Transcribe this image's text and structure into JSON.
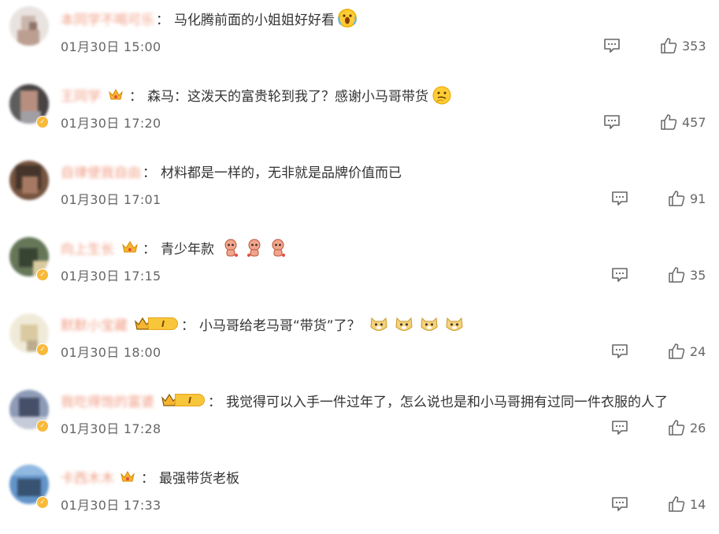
{
  "comments": [
    {
      "username": "本同学不喝可乐",
      "text": "马化腾前面的小姐姐好好看",
      "time": "01月30日 15:00",
      "likes": "353"
    },
    {
      "username": "王同学",
      "text": "森马：这泼天的富贵轮到我了？感谢小马哥带货",
      "time": "01月30日 17:20",
      "likes": "457"
    },
    {
      "username": "自律使我自由",
      "text": "材料都是一样的，无非就是品牌价值而已",
      "time": "01月30日 17:01",
      "likes": "91"
    },
    {
      "username": "向上生长",
      "text": "青少年款",
      "time": "01月30日 17:15",
      "likes": "35"
    },
    {
      "username": "默默小宝藏",
      "vip_level": "I",
      "text": "小马哥给老马哥“带货”了？",
      "time": "01月30日 18:00",
      "likes": "24"
    },
    {
      "username": "我吃得饱的富婆",
      "vip_level": "I",
      "text": "我觉得可以入手一件过年了，怎么说也是和小马哥拥有过同一件衣服的人了",
      "time": "01月30日 17:28",
      "likes": "26"
    },
    {
      "username": "卡西木木",
      "text": "最强带货老板",
      "time": "01月30日 17:33",
      "likes": "14"
    }
  ],
  "icons": {
    "reply": "comment-icon",
    "like": "thumbs-up-icon",
    "crown": "crown-icon",
    "verified": "verified-badge-icon"
  },
  "colors": {
    "username": "#eb7350",
    "text": "#333333",
    "meta": "#666666",
    "badge": "#f8c63a"
  }
}
